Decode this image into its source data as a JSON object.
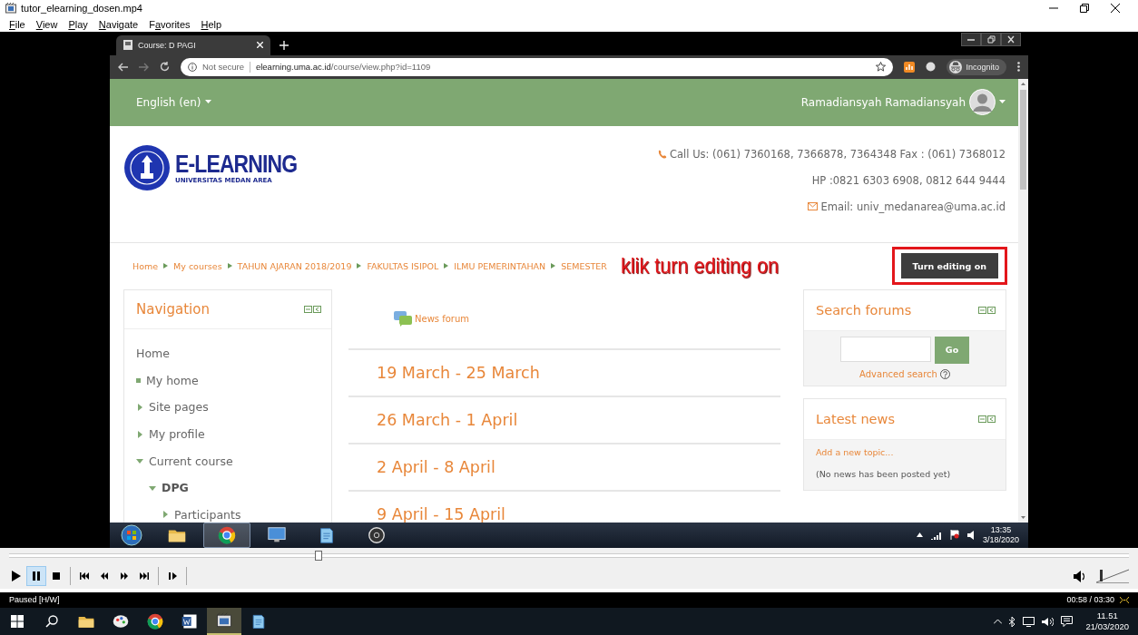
{
  "player": {
    "title": "tutor_elearning_dosen.mp4",
    "menu": [
      {
        "key": "F",
        "rest": "ile"
      },
      {
        "key": "V",
        "rest": "iew"
      },
      {
        "key": "P",
        "rest": "lay"
      },
      {
        "key": "N",
        "rest": "avigate"
      },
      {
        "lead": "F",
        "key": "a",
        "rest": "vorites"
      },
      {
        "key": "H",
        "rest": "elp"
      }
    ],
    "seek": {
      "level": 0.276
    },
    "controls": [
      {
        "kind": "play",
        "active": false
      },
      {
        "kind": "pause",
        "active": true
      },
      {
        "kind": "stop",
        "active": false
      },
      {
        "kind": "prev",
        "active": false
      },
      {
        "kind": "rewind",
        "active": false
      },
      {
        "kind": "forward",
        "active": false
      },
      {
        "kind": "next",
        "active": false
      },
      {
        "kind": "step",
        "active": false
      }
    ],
    "volume": {
      "level": 0.15
    },
    "status": "Paused [H/W]",
    "time": "00:58 / 03:30"
  },
  "browser": {
    "tab": "Course: D PAGI",
    "security": "Not secure",
    "url": "**elearning.uma.ac.id**/course/view.php?id=1109",
    "profile": "Incognito"
  },
  "site": {
    "language": "English (en)",
    "user": "Ramadiansyah Ramadiansyah",
    "logo_title": "E-LEARNING",
    "logo_subtitle": "UNIVERSITAS MEDAN AREA",
    "contacts": [
      {
        "kind": "phone",
        "text": "Call Us: (061) 7360168, 7366878, 7364348 Fax : (061) 7368012"
      },
      {
        "kind": "plain",
        "text": "HP :0821 6303 6908, 0812 644 9444"
      },
      {
        "kind": "mail",
        "text": "Email: univ_medanarea@uma.ac.id"
      }
    ],
    "breadcrumb": [
      "Home",
      "My courses",
      "TAHUN AJARAN 2018/2019",
      "FAKULTAS ISIPOL",
      "ILMU PEMERINTAHAN",
      "SEMESTER"
    ],
    "edit_button": "Turn editing on",
    "annotation": "klik turn editing on",
    "navigation": {
      "title": "Navigation",
      "items": [
        {
          "label": "Home",
          "kind": "plain",
          "current": false
        },
        {
          "label": "My home",
          "kind": "leaf",
          "current": false
        },
        {
          "label": "Site pages",
          "kind": "branch",
          "expanded": false,
          "current": false
        },
        {
          "label": "My profile",
          "kind": "branch",
          "expanded": false,
          "current": false
        },
        {
          "label": "Current course",
          "kind": "branch",
          "expanded": true,
          "current": false,
          "children": [
            {
              "label": "DPG",
              "kind": "branch",
              "expanded": true,
              "current": true,
              "children": [
                {
                  "label": "Participants",
                  "kind": "branch",
                  "expanded": false,
                  "current": false
                }
              ]
            }
          ]
        }
      ]
    },
    "news_forum": "News forum",
    "sections": [
      "19 March - 25 March",
      "26 March - 1 April",
      "2 April - 8 April",
      "9 April - 15 April"
    ],
    "search_block": {
      "title": "Search forums",
      "button": "Go",
      "advanced": "Advanced search"
    },
    "news_block": {
      "title": "Latest news",
      "add": "Add a new topic...",
      "empty": "(No news has been posted yet)"
    }
  },
  "inner_taskbar": {
    "apps": [
      {
        "kind": "folder",
        "active": false
      },
      {
        "kind": "browser",
        "active": true
      },
      {
        "kind": "remote",
        "active": false
      },
      {
        "kind": "notepad",
        "active": false
      },
      {
        "kind": "recorder",
        "active": false
      }
    ],
    "time": "13:35",
    "date": "3/18/2020"
  },
  "taskbar": {
    "apps": [
      {
        "kind": "folder",
        "active": false
      },
      {
        "kind": "paint",
        "active": false
      },
      {
        "kind": "browser",
        "active": false
      },
      {
        "kind": "word",
        "active": false
      },
      {
        "kind": "player",
        "active": true
      },
      {
        "kind": "notepad",
        "active": false
      }
    ],
    "time": "11.51",
    "date": "21/03/2020"
  }
}
